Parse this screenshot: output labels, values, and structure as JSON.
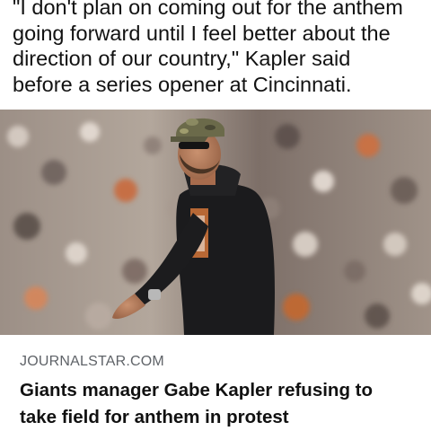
{
  "post": {
    "caption_lines": [
      "\"I don't plan on coming out for the anthem",
      "going forward until I feel better about the",
      "direction of our country,\" Kapler said",
      "before a series opener at Cincinnati."
    ]
  },
  "link_preview": {
    "image": "photo of Gabe Kapler in camouflage cap and black hoodie walking on field",
    "domain": "JOURNALSTAR.COM",
    "title_lines": [
      "Giants manager Gabe Kapler refusing to",
      "take field for anthem in protest"
    ]
  }
}
